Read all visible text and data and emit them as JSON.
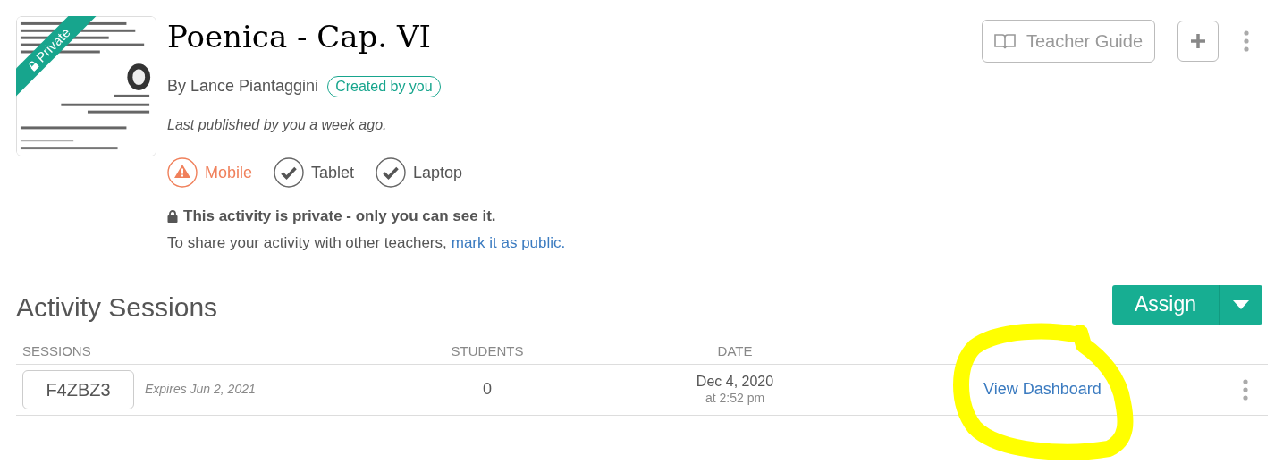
{
  "activity": {
    "ribbon": "Private",
    "title": "Poenica - Cap. VI",
    "author": "By Lance Piantaggini",
    "owner_badge": "Created by you",
    "published": "Last published by you a week ago.",
    "devices": [
      {
        "label": "Mobile",
        "supported": false
      },
      {
        "label": "Tablet",
        "supported": true
      },
      {
        "label": "Laptop",
        "supported": true
      }
    ],
    "privacy_notice": "This activity is private - only you can see it.",
    "share_text": "To share your activity with other teachers,",
    "share_link": "mark it as public."
  },
  "toolbar": {
    "teacher_guide": "Teacher Guide"
  },
  "sessions": {
    "heading": "Activity Sessions",
    "assign_button": "Assign",
    "columns": [
      "SESSIONS",
      "STUDENTS",
      "DATE"
    ],
    "rows": [
      {
        "code": "F4ZBZ3",
        "expires": "Expires Jun 2, 2021",
        "students": "0",
        "date": "Dec 4, 2020",
        "time": "at 2:52 pm",
        "action": "View Dashboard"
      }
    ]
  }
}
